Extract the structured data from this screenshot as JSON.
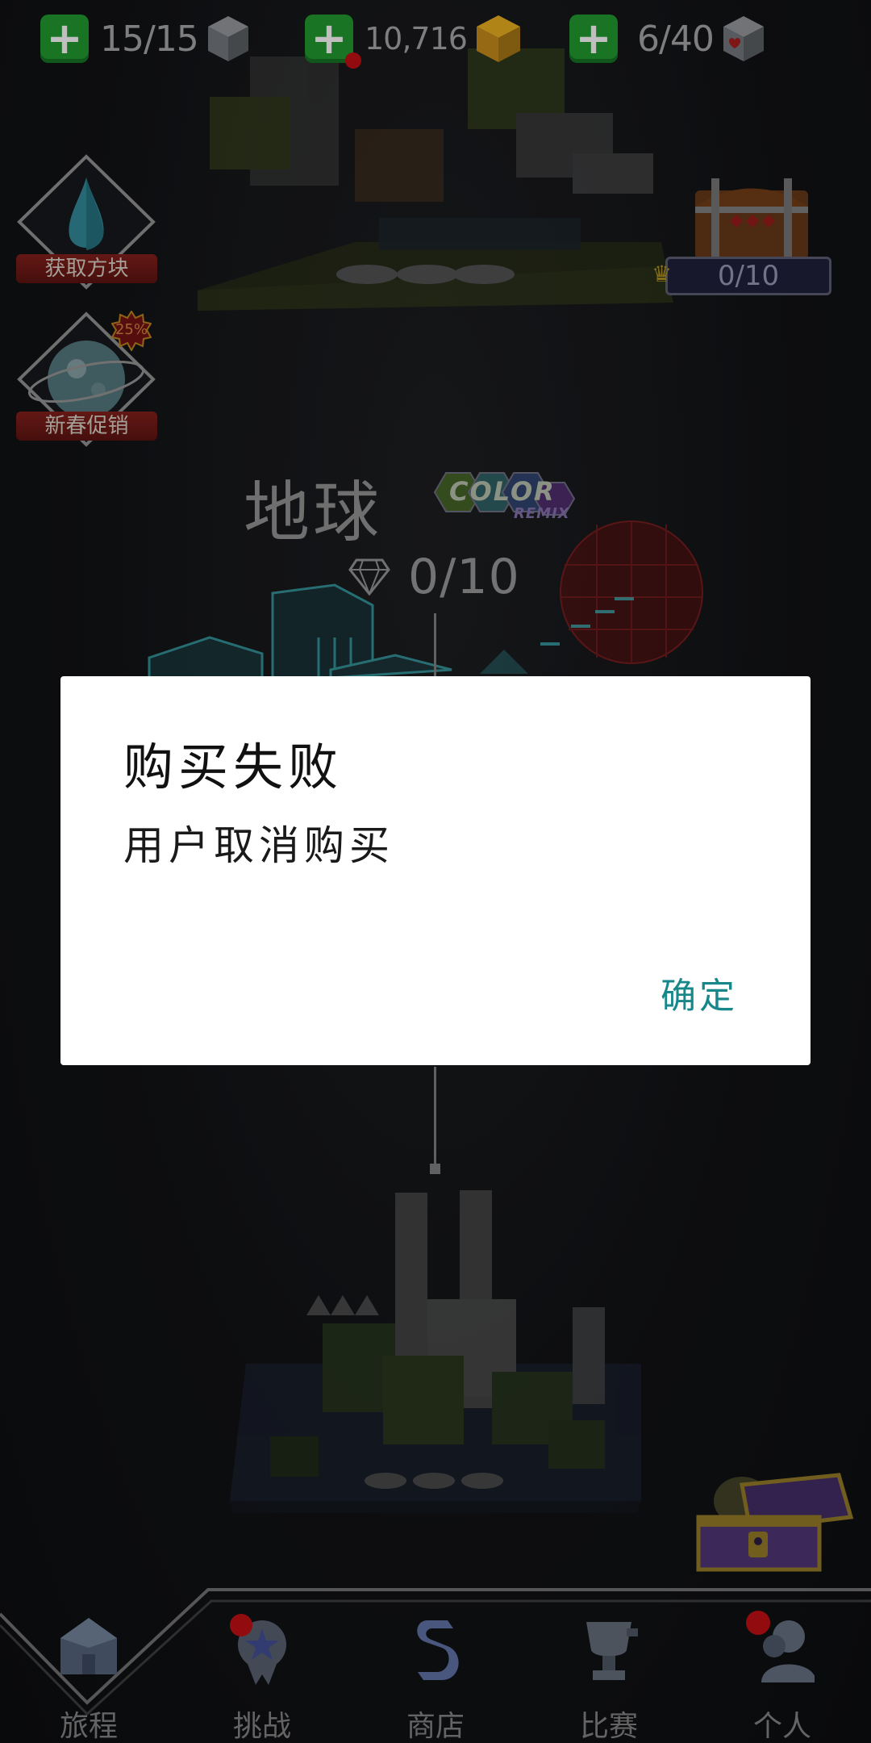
{
  "resources": [
    {
      "value": "15/15",
      "icon": "cube-icon"
    },
    {
      "value": "10,716",
      "icon": "gold-cube-icon"
    },
    {
      "value": "6/40",
      "icon": "heart-cube-icon"
    }
  ],
  "side_buttons": {
    "get_blocks": "获取方块",
    "promo": "新春促销",
    "promo_badge": "25%"
  },
  "level": {
    "name": "地球",
    "logo_text": "COLOR",
    "logo_subtext": "REMIX",
    "gem_progress": "0/10",
    "chest_progress": "0/10"
  },
  "dialog": {
    "title": "购买失败",
    "message": "用户取消购买",
    "ok": "确定"
  },
  "nav": [
    {
      "label": "旅程",
      "icon": "house-icon"
    },
    {
      "label": "挑战",
      "icon": "medal-icon"
    },
    {
      "label": "商店",
      "icon": "dollar-icon"
    },
    {
      "label": "比赛",
      "icon": "trophy-icon"
    },
    {
      "label": "个人",
      "icon": "profile-icon"
    }
  ],
  "colors": {
    "plus_green": "#1f8e2c",
    "dialog_button": "#17878a",
    "notification_red": "#b30f13"
  }
}
